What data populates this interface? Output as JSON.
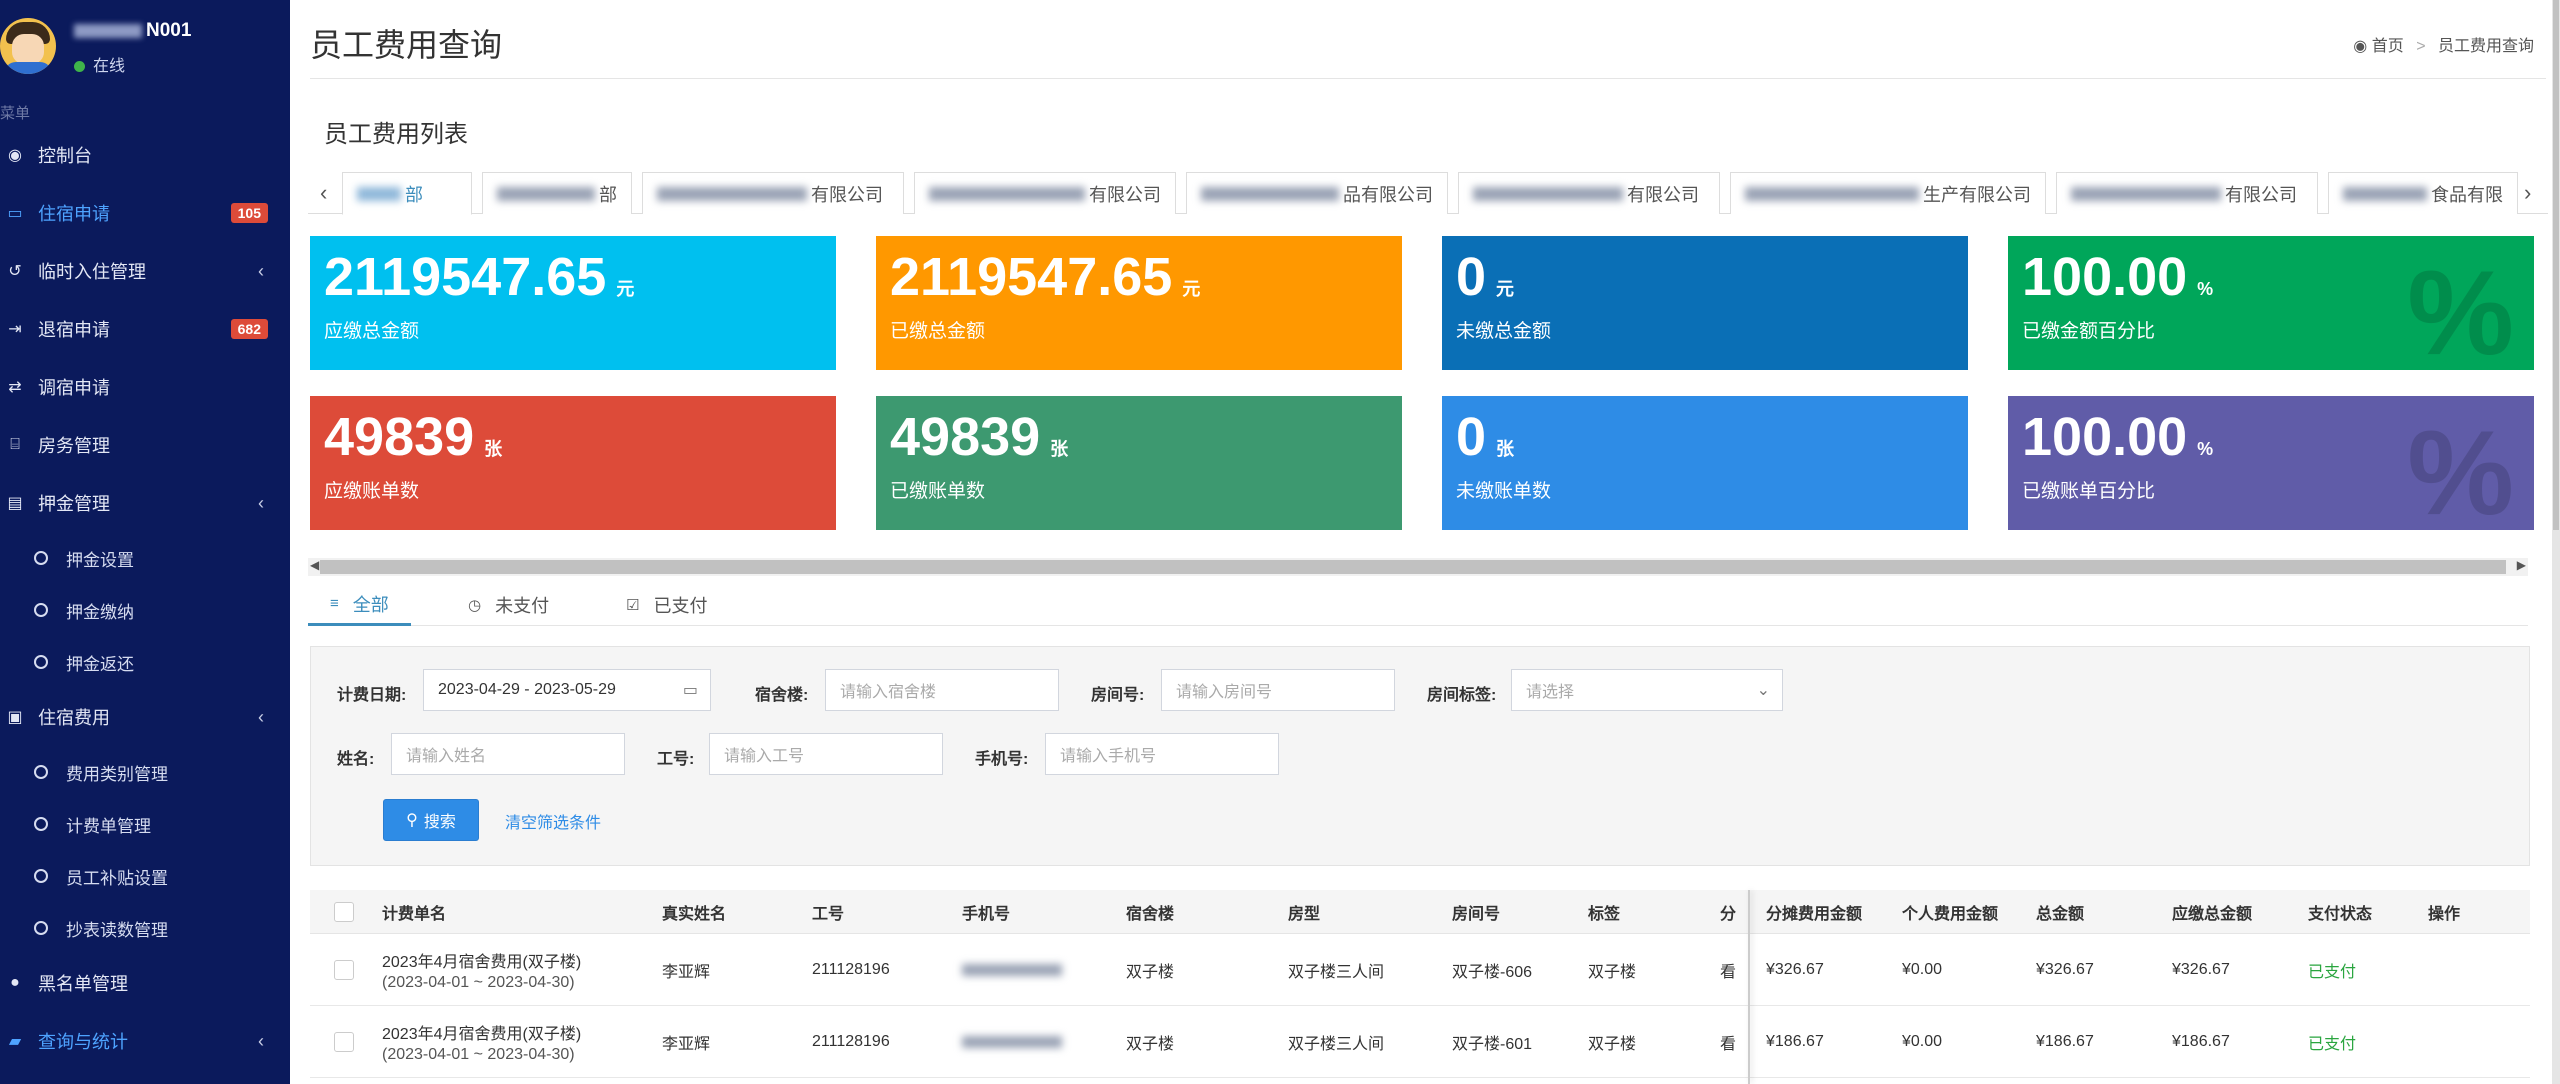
{
  "sidebar": {
    "user": {
      "name_suffix": "N001",
      "status": "在线"
    },
    "menu_header": "菜单",
    "items": [
      {
        "label": "控制台",
        "icon": "dashboard-icon"
      },
      {
        "label": "住宿申请",
        "icon": "list-icon",
        "badge": "105",
        "active": true
      },
      {
        "label": "临时入住管理",
        "icon": "history-icon",
        "chevron": "‹"
      },
      {
        "label": "退宿申请",
        "icon": "sign-out-icon",
        "badge": "682"
      },
      {
        "label": "调宿申请",
        "icon": "exchange-icon"
      },
      {
        "label": "房务管理",
        "icon": "bed-icon"
      },
      {
        "label": "押金管理",
        "icon": "card-icon",
        "chevron": "‹"
      },
      {
        "label": "押金设置",
        "sub": true
      },
      {
        "label": "押金缴纳",
        "sub": true
      },
      {
        "label": "押金返还",
        "sub": true
      },
      {
        "label": "住宿费用",
        "icon": "money-icon",
        "chevron": "‹"
      },
      {
        "label": "费用类别管理",
        "sub": true
      },
      {
        "label": "计费单管理",
        "sub": true
      },
      {
        "label": "员工补贴设置",
        "sub": true
      },
      {
        "label": "抄表读数管理",
        "sub": true
      },
      {
        "label": "黑名单管理",
        "icon": "user-icon"
      },
      {
        "label": "查询与统计",
        "icon": "book-icon",
        "chevron": "‹",
        "active": true
      }
    ]
  },
  "header": {
    "title": "员工费用查询",
    "breadcrumb_home": "首页",
    "breadcrumb_current": "员工费用查询"
  },
  "section_title": "员工费用列表",
  "company_tabs": [
    {
      "visible": "部",
      "active": true
    },
    {
      "visible": "部"
    },
    {
      "visible": "有限公司"
    },
    {
      "visible": "有限公司"
    },
    {
      "visible": "品有限公司"
    },
    {
      "visible": "有限公司"
    },
    {
      "visible": "生产有限公司"
    },
    {
      "visible": "有限公司"
    },
    {
      "visible": "食品有限"
    }
  ],
  "stats": [
    {
      "value": "2119547.65",
      "unit": "元",
      "label": "应缴总金额",
      "color": "#00c0ef"
    },
    {
      "value": "2119547.65",
      "unit": "元",
      "label": "已缴总金额",
      "color": "#ff9800"
    },
    {
      "value": "0",
      "unit": "元",
      "label": "未缴总金额",
      "color": "#0a6fb6"
    },
    {
      "value": "100.00",
      "unit": "%",
      "label": "已缴金额百分比",
      "color": "#00a65a",
      "bg_icon": "%"
    },
    {
      "value": "49839",
      "unit": "张",
      "label": "应缴账单数",
      "color": "#dd4b39"
    },
    {
      "value": "49839",
      "unit": "张",
      "label": "已缴账单数",
      "color": "#3d9970"
    },
    {
      "value": "0",
      "unit": "张",
      "label": "未缴账单数",
      "color": "#2e8ce6"
    },
    {
      "value": "100.00",
      "unit": "%",
      "label": "已缴账单百分比",
      "color": "#605ca8",
      "bg_icon": "%"
    }
  ],
  "status_tabs": [
    {
      "label": "全部",
      "icon": "≡",
      "active": true
    },
    {
      "label": "未支付",
      "icon": "◷"
    },
    {
      "label": "已支付",
      "icon": "☑"
    }
  ],
  "filters": {
    "date_label": "计费日期:",
    "date_value": "2023-04-29 - 2023-05-29",
    "building_label": "宿舍楼:",
    "building_placeholder": "请输入宿舍楼",
    "room_label": "房间号:",
    "room_placeholder": "请输入房间号",
    "tag_label": "房间标签:",
    "tag_placeholder": "请选择",
    "name_label": "姓名:",
    "name_placeholder": "请输入姓名",
    "empno_label": "工号:",
    "empno_placeholder": "请输入工号",
    "phone_label": "手机号:",
    "phone_placeholder": "请输入手机号",
    "search_button": "搜索",
    "clear_button": "清空筛选条件"
  },
  "table": {
    "headers": [
      "计费单名",
      "真实姓名",
      "工号",
      "手机号",
      "宿舍楼",
      "房型",
      "房间号",
      "标签",
      "分",
      "分摊费用金额",
      "个人费用金额",
      "总金额",
      "应缴总金额",
      "支付状态",
      "操作"
    ],
    "rows": [
      {
        "bill_name": "2023年4月宿舍费用(双子楼)",
        "bill_period": "(2023-04-01 ~ 2023-04-30)",
        "name": "李亚辉",
        "emp_no": "211128196",
        "building": "双子楼",
        "room_type": "双子楼三人间",
        "room_no": "双子楼-606",
        "tag": "双子楼",
        "cut": "看",
        "shared": "¥326.67",
        "personal": "¥0.00",
        "total": "¥326.67",
        "due": "¥326.67",
        "status": "已支付"
      },
      {
        "bill_name": "2023年4月宿舍费用(双子楼)",
        "bill_period": "(2023-04-01 ~ 2023-04-30)",
        "name": "李亚辉",
        "emp_no": "211128196",
        "building": "双子楼",
        "room_type": "双子楼三人间",
        "room_no": "双子楼-601",
        "tag": "双子楼",
        "cut": "看",
        "shared": "¥186.67",
        "personal": "¥0.00",
        "total": "¥186.67",
        "due": "¥186.67",
        "status": "已支付"
      }
    ]
  }
}
